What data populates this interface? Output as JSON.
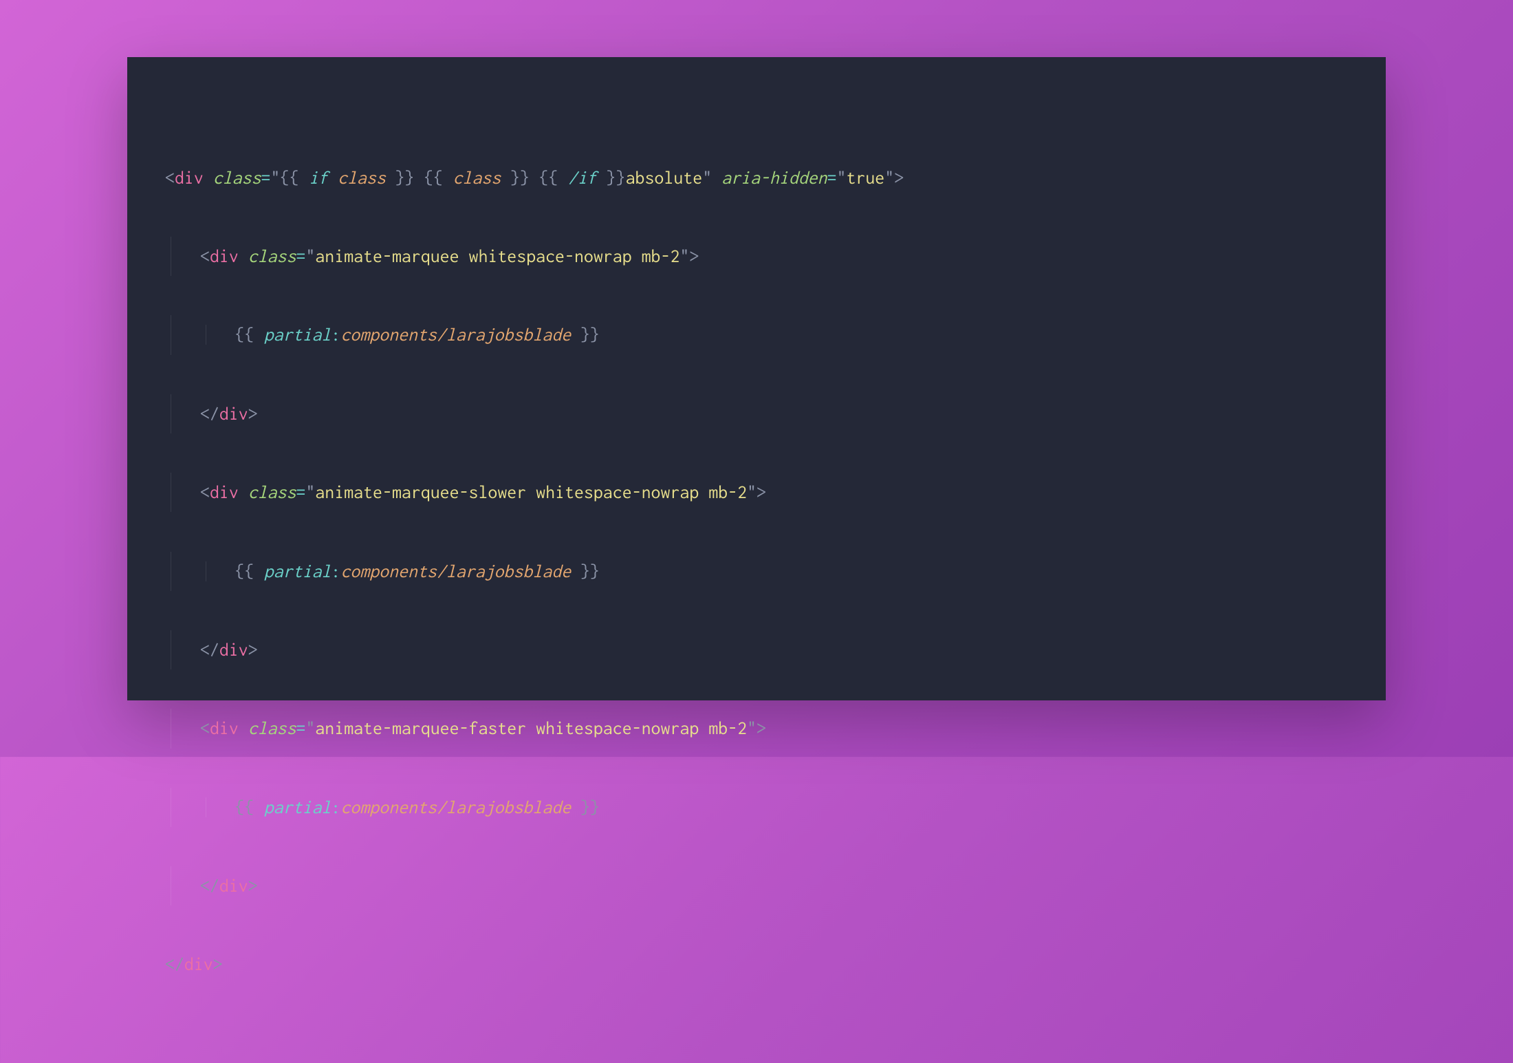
{
  "colors": {
    "bg_gradient_from": "#d265d6",
    "bg_gradient_to": "#9c3fb5",
    "panel_bg": "#242837",
    "punct": "#8b93a7",
    "tag": "#eb6fa4",
    "attr": "#a6d67c",
    "operator": "#6bd1c9",
    "string": "#e7de8c",
    "keyword": "#6bd1c9",
    "variable": "#e3a66f"
  },
  "code": {
    "l1": {
      "open": "<",
      "tag": "div",
      "sp": " ",
      "attr1": "class",
      "eq": "=",
      "q": "\"",
      "m1": "{{ ",
      "kw_if": "if",
      "sp2": " ",
      "var_class": "class",
      "m1c": " }}",
      "sp3": " ",
      "m2": "{{ ",
      "var_class2": "class",
      "m2c": " }}",
      "sp4": " ",
      "m3": "{{ ",
      "kw_endif": "/if",
      "m3c": " }}",
      "str_abs": "absolute",
      "sp5": " ",
      "attr2": "aria-hidden",
      "val2": "true",
      "close": ">"
    },
    "l2": {
      "open": "<",
      "tag": "div",
      "sp": " ",
      "attr": "class",
      "eq": "=",
      "q": "\"",
      "val": "animate-marquee whitespace-nowrap mb-2",
      "close": ">"
    },
    "l3": {
      "m_open": "{{ ",
      "kw": "partial",
      "colon": ":",
      "path": "components/larajobsblade",
      "m_close": " }}"
    },
    "l4": {
      "open": "</",
      "tag": "div",
      "close": ">"
    },
    "l5": {
      "open": "<",
      "tag": "div",
      "sp": " ",
      "attr": "class",
      "eq": "=",
      "q": "\"",
      "val": "animate-marquee-slower whitespace-nowrap mb-2",
      "close": ">"
    },
    "l6": {
      "m_open": "{{ ",
      "kw": "partial",
      "colon": ":",
      "path": "components/larajobsblade",
      "m_close": " }}"
    },
    "l7": {
      "open": "</",
      "tag": "div",
      "close": ">"
    },
    "l8": {
      "open": "<",
      "tag": "div",
      "sp": " ",
      "attr": "class",
      "eq": "=",
      "q": "\"",
      "val": "animate-marquee-faster whitespace-nowrap mb-2",
      "close": ">"
    },
    "l9": {
      "m_open": "{{ ",
      "kw": "partial",
      "colon": ":",
      "path": "components/larajobsblade",
      "m_close": " }}"
    },
    "l10": {
      "open": "</",
      "tag": "div",
      "close": ">"
    },
    "l11": {
      "open": "</",
      "tag": "div",
      "close": ">"
    }
  }
}
